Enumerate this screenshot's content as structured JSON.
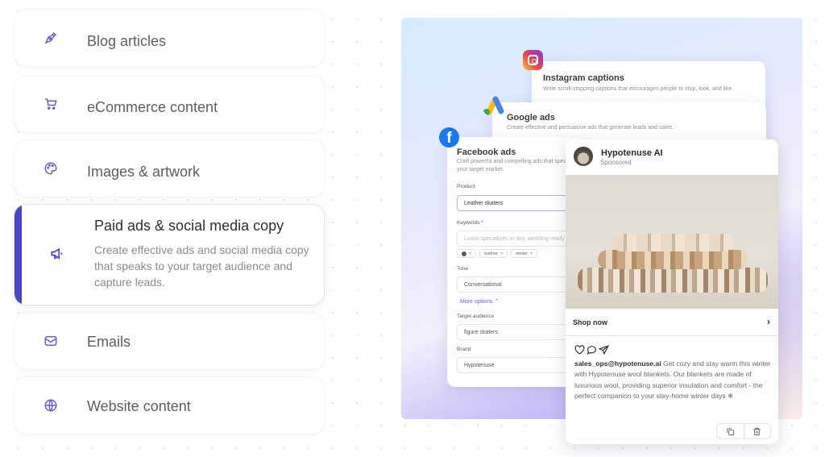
{
  "sidebar": {
    "items": [
      {
        "label": "Blog articles",
        "icon": "pen-nib-icon"
      },
      {
        "label": "eCommerce content",
        "icon": "shopping-cart-icon"
      },
      {
        "label": "Images & artwork",
        "icon": "palette-icon"
      },
      {
        "label": "Paid ads & social media copy",
        "icon": "megaphone-icon",
        "active": true,
        "description": "Create effective ads and social media copy that speaks to your target audience and capture leads."
      },
      {
        "label": "Emails",
        "icon": "mail-icon"
      },
      {
        "label": "Website content",
        "icon": "globe-icon"
      }
    ],
    "accent": "#4a43cf"
  },
  "preview": {
    "instagram": {
      "title": "Instagram captions",
      "description": "Write scroll-stopping captions that encourages people to stop, look, and like."
    },
    "google": {
      "title": "Google ads",
      "description": "Create effective and persuasive ads that generate leads and sales."
    },
    "facebook": {
      "title": "Facebook ads",
      "description": "Craft powerful and compelling ads that speak to your target market.",
      "fields": {
        "product_label": "Product",
        "product_value": "Leather skaters",
        "keywords_label": "Keywords *",
        "keywords_placeholder": "Luxco specializes in airy, wedding-ready",
        "keyword_chips": [
          "leather",
          "winter"
        ],
        "tone_label": "Tone",
        "tone_value": "Conversational",
        "more_options": "More options ⌃",
        "audience_label": "Target audience",
        "audience_value": "figure skaters",
        "brand_label": "Brand",
        "brand_value": "Hypotenuse"
      }
    },
    "post": {
      "name": "Hypotenuse AI",
      "sponsored": "Sponsored",
      "cta": "Shop now",
      "handle": "sales_ops@hypotenuse.ai",
      "caption": " Get cozy and stay warm this winter with Hypotenuse wool blankets. Our blankets are made of luxurious wool, providing superior insulation and comfort - the perfect companion to your stay-home winter days ❄"
    }
  }
}
